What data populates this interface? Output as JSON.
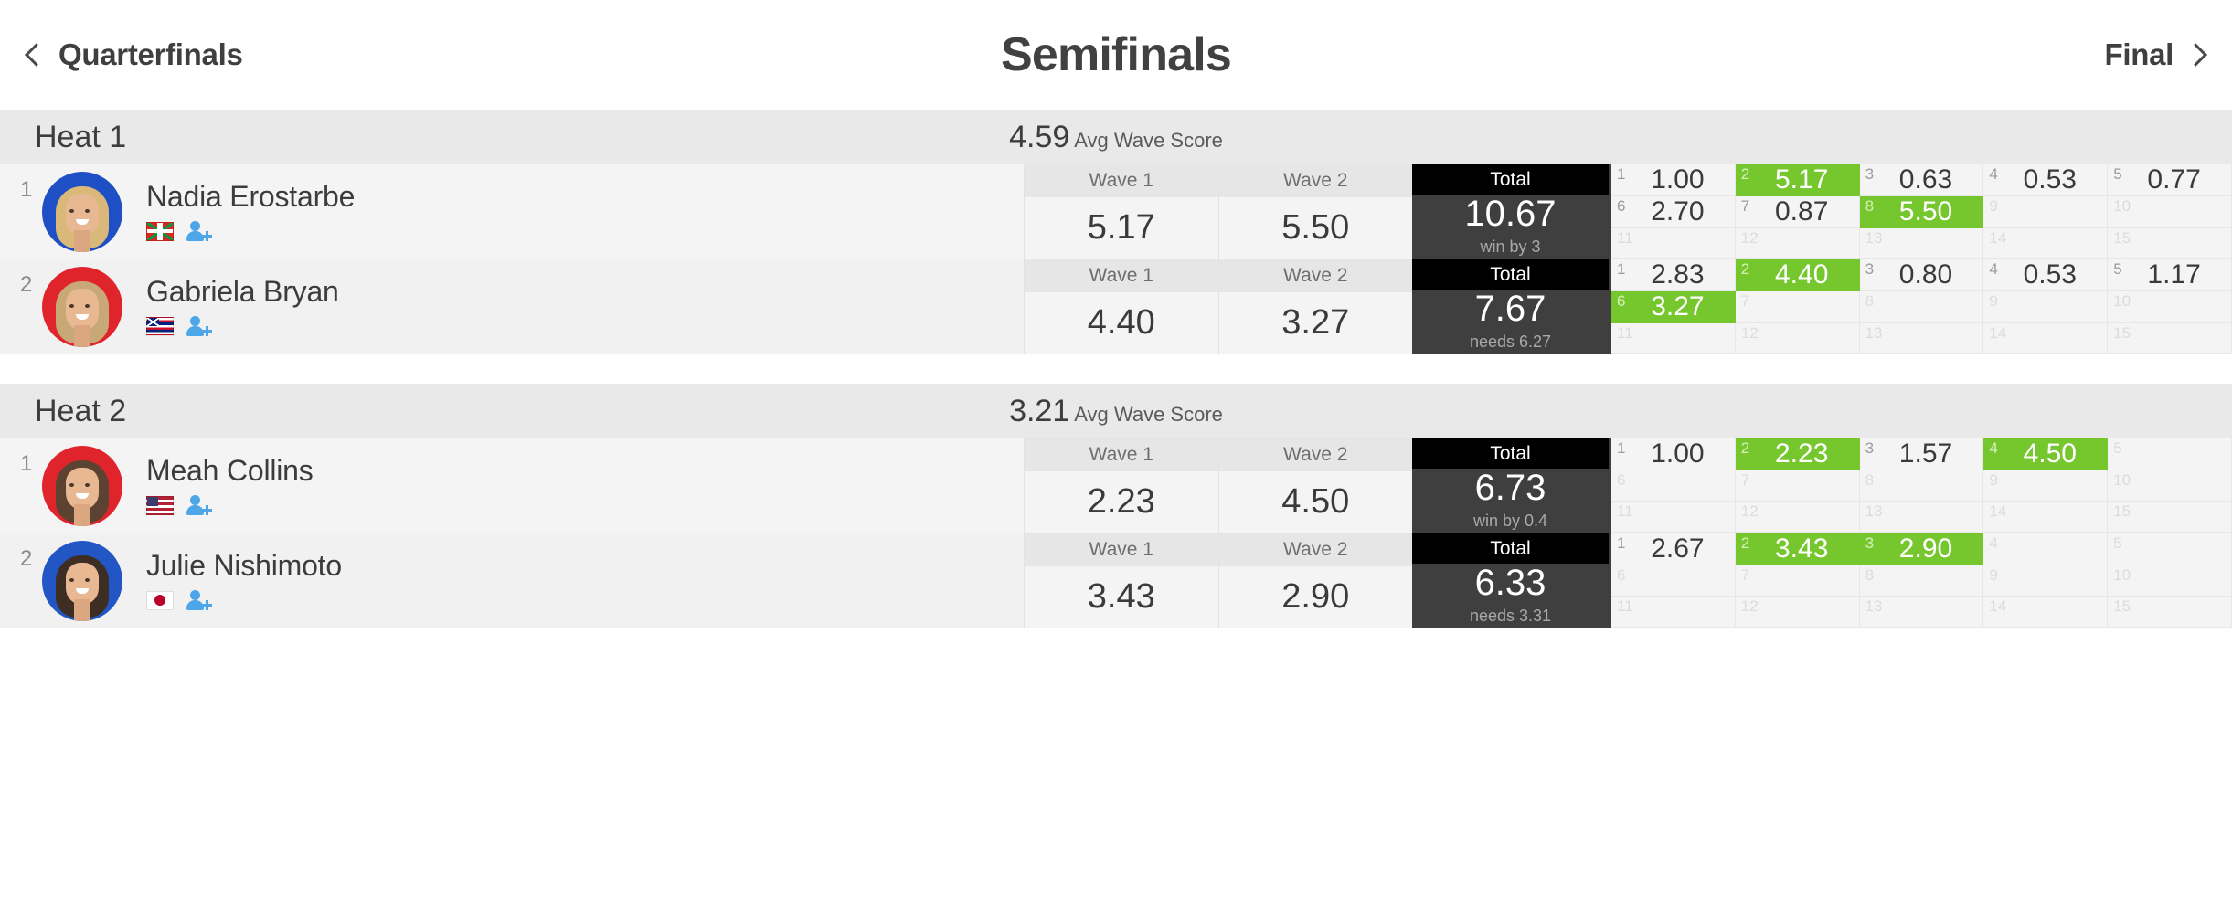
{
  "header": {
    "prev_round": "Quarterfinals",
    "title": "Semifinals",
    "next_round": "Final",
    "prev_icon": "chevron-left-icon",
    "next_icon": "chevron-right-icon"
  },
  "column_headers": {
    "wave1": "Wave 1",
    "wave2": "Wave 2",
    "total": "Total"
  },
  "avg_label": "Avg Wave Score",
  "heats": [
    {
      "name": "Heat 1",
      "avg_wave_score": "4.59",
      "athletes": [
        {
          "rank": "1",
          "name": "Nadia Erostarbe",
          "flag": "basque",
          "jersey_color": "#1f4fc4",
          "hair_color": "#d9b87a",
          "wave1": "5.17",
          "wave2": "5.50",
          "total": "10.67",
          "note": "win by 3",
          "waves": [
            {
              "n": "1",
              "v": "1.00",
              "counted": false
            },
            {
              "n": "2",
              "v": "5.17",
              "counted": true
            },
            {
              "n": "3",
              "v": "0.63",
              "counted": false
            },
            {
              "n": "4",
              "v": "0.53",
              "counted": false
            },
            {
              "n": "5",
              "v": "0.77",
              "counted": false
            },
            {
              "n": "6",
              "v": "2.70",
              "counted": false
            },
            {
              "n": "7",
              "v": "0.87",
              "counted": false
            },
            {
              "n": "8",
              "v": "5.50",
              "counted": true
            },
            {
              "n": "9",
              "v": "",
              "counted": false
            },
            {
              "n": "10",
              "v": "",
              "counted": false
            },
            {
              "n": "11",
              "v": "",
              "counted": false
            },
            {
              "n": "12",
              "v": "",
              "counted": false
            },
            {
              "n": "13",
              "v": "",
              "counted": false
            },
            {
              "n": "14",
              "v": "",
              "counted": false
            },
            {
              "n": "15",
              "v": "",
              "counted": false
            }
          ]
        },
        {
          "rank": "2",
          "name": "Gabriela Bryan",
          "flag": "hawaii",
          "jersey_color": "#e0242c",
          "hair_color": "#c9a878",
          "wave1": "4.40",
          "wave2": "3.27",
          "total": "7.67",
          "note": "needs 6.27",
          "waves": [
            {
              "n": "1",
              "v": "2.83",
              "counted": false
            },
            {
              "n": "2",
              "v": "4.40",
              "counted": true
            },
            {
              "n": "3",
              "v": "0.80",
              "counted": false
            },
            {
              "n": "4",
              "v": "0.53",
              "counted": false
            },
            {
              "n": "5",
              "v": "1.17",
              "counted": false
            },
            {
              "n": "6",
              "v": "3.27",
              "counted": true
            },
            {
              "n": "7",
              "v": "",
              "counted": false
            },
            {
              "n": "8",
              "v": "",
              "counted": false
            },
            {
              "n": "9",
              "v": "",
              "counted": false
            },
            {
              "n": "10",
              "v": "",
              "counted": false
            },
            {
              "n": "11",
              "v": "",
              "counted": false
            },
            {
              "n": "12",
              "v": "",
              "counted": false
            },
            {
              "n": "13",
              "v": "",
              "counted": false
            },
            {
              "n": "14",
              "v": "",
              "counted": false
            },
            {
              "n": "15",
              "v": "",
              "counted": false
            }
          ]
        }
      ]
    },
    {
      "name": "Heat 2",
      "avg_wave_score": "3.21",
      "athletes": [
        {
          "rank": "1",
          "name": "Meah Collins",
          "flag": "usa",
          "jersey_color": "#e0242c",
          "hair_color": "#5c4331",
          "wave1": "2.23",
          "wave2": "4.50",
          "total": "6.73",
          "note": "win by 0.4",
          "waves": [
            {
              "n": "1",
              "v": "1.00",
              "counted": false
            },
            {
              "n": "2",
              "v": "2.23",
              "counted": true
            },
            {
              "n": "3",
              "v": "1.57",
              "counted": false
            },
            {
              "n": "4",
              "v": "4.50",
              "counted": true
            },
            {
              "n": "5",
              "v": "",
              "counted": false
            },
            {
              "n": "6",
              "v": "",
              "counted": false
            },
            {
              "n": "7",
              "v": "",
              "counted": false
            },
            {
              "n": "8",
              "v": "",
              "counted": false
            },
            {
              "n": "9",
              "v": "",
              "counted": false
            },
            {
              "n": "10",
              "v": "",
              "counted": false
            },
            {
              "n": "11",
              "v": "",
              "counted": false
            },
            {
              "n": "12",
              "v": "",
              "counted": false
            },
            {
              "n": "13",
              "v": "",
              "counted": false
            },
            {
              "n": "14",
              "v": "",
              "counted": false
            },
            {
              "n": "15",
              "v": "",
              "counted": false
            }
          ]
        },
        {
          "rank": "2",
          "name": "Julie Nishimoto",
          "flag": "japan",
          "jersey_color": "#2256c5",
          "hair_color": "#3e2d22",
          "wave1": "3.43",
          "wave2": "2.90",
          "total": "6.33",
          "note": "needs 3.31",
          "waves": [
            {
              "n": "1",
              "v": "2.67",
              "counted": false
            },
            {
              "n": "2",
              "v": "3.43",
              "counted": true
            },
            {
              "n": "3",
              "v": "2.90",
              "counted": true
            },
            {
              "n": "4",
              "v": "",
              "counted": false
            },
            {
              "n": "5",
              "v": "",
              "counted": false
            },
            {
              "n": "6",
              "v": "",
              "counted": false
            },
            {
              "n": "7",
              "v": "",
              "counted": false
            },
            {
              "n": "8",
              "v": "",
              "counted": false
            },
            {
              "n": "9",
              "v": "",
              "counted": false
            },
            {
              "n": "10",
              "v": "",
              "counted": false
            },
            {
              "n": "11",
              "v": "",
              "counted": false
            },
            {
              "n": "12",
              "v": "",
              "counted": false
            },
            {
              "n": "13",
              "v": "",
              "counted": false
            },
            {
              "n": "14",
              "v": "",
              "counted": false
            },
            {
              "n": "15",
              "v": "",
              "counted": false
            }
          ]
        }
      ]
    }
  ],
  "colors": {
    "counted_wave_green": "#76c72e",
    "total_header": "#000000",
    "total_body": "#3f3f3f"
  }
}
